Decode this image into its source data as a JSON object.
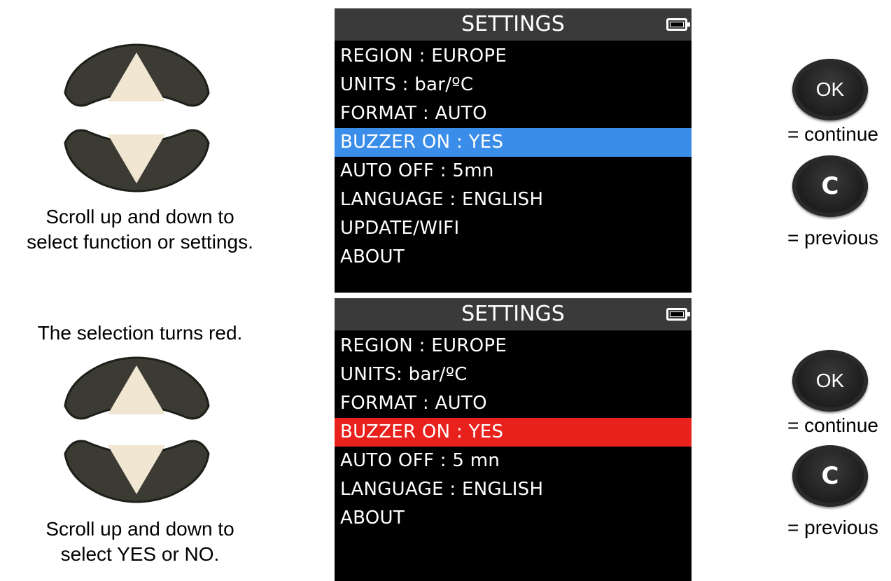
{
  "left_panel": {
    "top_caption_line1": "Scroll up and down to",
    "top_caption_line2": "select function or settings.",
    "middle_caption": "The selection turns red.",
    "bottom_caption_line1": "Scroll up and down to",
    "bottom_caption_line2": "select YES or NO."
  },
  "screen_top": {
    "title": "SETTINGS",
    "items": [
      "REGION : EUROPE",
      "UNITS : bar/ºC",
      "FORMAT : AUTO",
      "BUZZER ON : YES",
      "AUTO OFF : 5mn",
      "LANGUAGE : ENGLISH",
      "UPDATE/WIFI",
      "ABOUT"
    ],
    "selected_index": 3,
    "highlight_color": "#3a8de8"
  },
  "screen_bottom": {
    "title": "SETTINGS",
    "items": [
      "REGION : EUROPE",
      "UNITS: bar/ºC",
      "FORMAT : AUTO",
      "BUZZER ON : YES",
      "AUTO OFF : 5 mn",
      "LANGUAGE : ENGLISH",
      "ABOUT"
    ],
    "selected_index": 3,
    "highlight_color": "#e8211c"
  },
  "right_panel": {
    "ok_label": "OK",
    "c_label": "C",
    "continue_text": "= continue",
    "previous_text": "= previous"
  },
  "icons": [
    "up-arrow-button-icon",
    "down-arrow-button-icon",
    "battery-icon",
    "ok-button-icon",
    "c-button-icon"
  ]
}
